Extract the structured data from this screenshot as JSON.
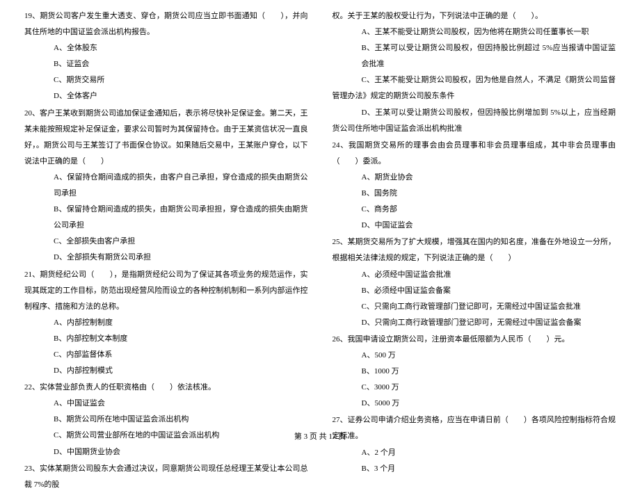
{
  "leftColumn": {
    "q19": {
      "text": "19、期货公司客户发生重大透支、穿仓，期货公司应当立即书面通知（　　），并向其住所地的中国证监会派出机构报告。",
      "optA": "A、全体股东",
      "optB": "B、证监会",
      "optC": "C、期货交易所",
      "optD": "D、全体客户"
    },
    "q20": {
      "text": "20、客户王某收到期货公司追加保证金通知后，表示将尽快补足保证金。第二天，王某未能按照规定补足保证金，要求公司暂时为其保留持仓。由于王某资信状况一直良好，。期货公司与王某签订了书面保仓协议。如果随后交易中，王某账户穿仓，以下说法中正确的是（　　）",
      "optA": "A、保留持仓期间造成的损失，由客户自己承担，穿仓造成的损失由期货公司承担",
      "optB": "B、保留持仓期间造成的损失，由期货公司承担担，穿仓造成的损失由期货公司承担",
      "optC": "C、全部损失由客户承担",
      "optD": "D、全部损失有期货公司承担"
    },
    "q21": {
      "text": "21、期货经纪公司（　　），是指期货经纪公司为了保证其各项业务的规范运作，实现其既定的工作目标，防范出现经营风险而设立的各种控制机制和一系列内部运作控制程序、措施和方法的总称。",
      "optA": "A、内部控制制度",
      "optB": "B、内部控制文本制度",
      "optC": "C、内部监督体系",
      "optD": "D、内部控制模式"
    },
    "q22": {
      "text": "22、实体营业部负责人的任职资格由（　　）依法核准。",
      "optA": "A、中国证监会",
      "optB": "B、期货公司所在地中国证监会派出机构",
      "optC": "C、期货公司营业部所在地的中国证监会派出机构",
      "optD": "D、中国期货业协会"
    },
    "q23": {
      "text": "23、实体某期货公司股东大会通过决议，同意期货公司现任总经理王某受让本公司总裁 7%的股"
    }
  },
  "rightColumn": {
    "q23cont": {
      "line1": "权。关于王某的股权受让行为，下列说法中正确的是（　　）。",
      "optA": "A、王某不能受让期货公司股权，因为他将在期货公司任董事长一职",
      "optB": "B、王某可以受让期货公司股权，但因持股比例超过 5%应当报请中国证监会批准",
      "optC": "C、王某不能受让期货公司股权，因为他是自然人，不满足《期货公司监督管理办法》规定的期货公司股东条件",
      "optD": "D、王某可以受让期货公司股权，但因持股比例增加到 5%以上，应当经期货公司住所地中国证监会派出机构批准"
    },
    "q24": {
      "text": "24、我国期货交易所的理事会由会员理事和非会员理事组成，其中非会员理事由（　　）委派。",
      "optA": "A、期货业协会",
      "optB": "B、国务院",
      "optC": "C、商务部",
      "optD": "D、中国证监会"
    },
    "q25": {
      "text": "25、某期货交易所为了扩大规模，增强其在国内的知名度，准备在外地设立一分所，根据相关法律法规的规定，下列说法正确的是（　　）",
      "optA": "A、必须经中国证监会批准",
      "optB": "B、必须经中国证监会备案",
      "optC": "C、只需向工商行政管理部门登记即可，无需经过中国证监会批准",
      "optD": "D、只需向工商行政管理部门登记即可，无需经过中国证监会备案"
    },
    "q26": {
      "text": "26、我国申请设立期货公司，注册资本最低限额为人民币（　　）元。",
      "optA": "A、500 万",
      "optB": "B、1000 万",
      "optC": "C、3000 万",
      "optD": "D、5000 万"
    },
    "q27": {
      "text": "27、证券公司申请介绍业务资格，应当在申请日前（　　）各项风险控制指标符合规定标准。",
      "optA": "A、2 个月",
      "optB": "B、3 个月"
    }
  },
  "footer": "第 3 页 共 17 页"
}
